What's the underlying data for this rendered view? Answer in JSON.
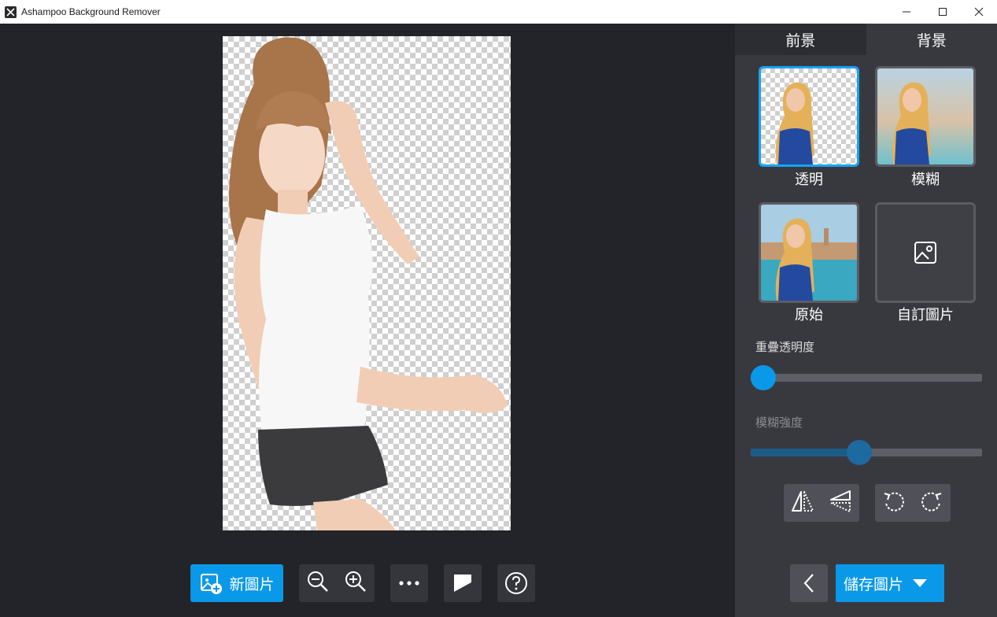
{
  "window": {
    "title": "Ashampoo Background Remover"
  },
  "tabs": [
    {
      "label": "前景"
    },
    {
      "label": "背景"
    }
  ],
  "backgrounds": [
    {
      "label": "透明",
      "selected": true
    },
    {
      "label": "模糊",
      "selected": false
    },
    {
      "label": "原始",
      "selected": false
    },
    {
      "label": "自訂圖片",
      "selected": false
    }
  ],
  "sliders": {
    "overlay": {
      "label": "重疊透明度",
      "value": 0
    },
    "blur": {
      "label": "模糊強度",
      "value": 0.47,
      "disabled": true
    }
  },
  "toolbar": {
    "new_image_label": "新圖片"
  },
  "save": {
    "label": "儲存圖片"
  },
  "colors": {
    "accent": "#0a98e8",
    "panel": "#38393f",
    "canvas": "#232429"
  }
}
